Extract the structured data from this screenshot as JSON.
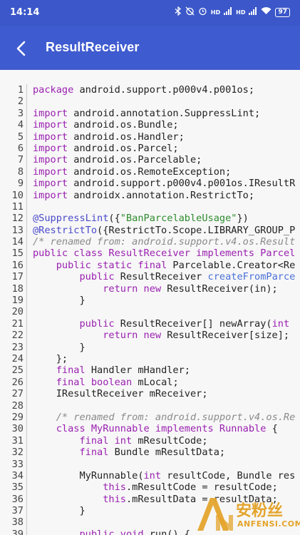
{
  "status_bar": {
    "time": "14:14",
    "network_labels": [
      "HD",
      "HD"
    ],
    "battery": "97"
  },
  "app_bar": {
    "title": "ResultReceiver"
  },
  "code_lines": [
    {
      "n": "1",
      "tokens": [
        {
          "t": "k",
          "v": "package"
        },
        {
          "t": "n",
          "v": " android.support.p000v4.p001os;"
        }
      ]
    },
    {
      "n": "2",
      "tokens": []
    },
    {
      "n": "3",
      "tokens": [
        {
          "t": "k",
          "v": "import"
        },
        {
          "t": "n",
          "v": " android.annotation.SuppressLint;"
        }
      ]
    },
    {
      "n": "4",
      "tokens": [
        {
          "t": "k",
          "v": "import"
        },
        {
          "t": "n",
          "v": " android.os.Bundle;"
        }
      ]
    },
    {
      "n": "5",
      "tokens": [
        {
          "t": "k",
          "v": "import"
        },
        {
          "t": "n",
          "v": " android.os.Handler;"
        }
      ]
    },
    {
      "n": "6",
      "tokens": [
        {
          "t": "k",
          "v": "import"
        },
        {
          "t": "n",
          "v": " android.os.Parcel;"
        }
      ]
    },
    {
      "n": "7",
      "tokens": [
        {
          "t": "k",
          "v": "import"
        },
        {
          "t": "n",
          "v": " android.os.Parcelable;"
        }
      ]
    },
    {
      "n": "8",
      "tokens": [
        {
          "t": "k",
          "v": "import"
        },
        {
          "t": "n",
          "v": " android.os.RemoteException;"
        }
      ]
    },
    {
      "n": "9",
      "tokens": [
        {
          "t": "k",
          "v": "import"
        },
        {
          "t": "n",
          "v": " android.support.p000v4.p001os.IResultR"
        }
      ]
    },
    {
      "n": "10",
      "tokens": [
        {
          "t": "k",
          "v": "import"
        },
        {
          "t": "n",
          "v": " androidx.annotation.RestrictTo;"
        }
      ]
    },
    {
      "n": "11",
      "tokens": []
    },
    {
      "n": "12",
      "tokens": [
        {
          "t": "a",
          "v": "@SuppressLint"
        },
        {
          "t": "n",
          "v": "({"
        },
        {
          "t": "s",
          "v": "\"BanParcelableUsage\""
        },
        {
          "t": "n",
          "v": "})"
        }
      ]
    },
    {
      "n": "13",
      "tokens": [
        {
          "t": "a",
          "v": "@RestrictTo"
        },
        {
          "t": "n",
          "v": "({RestrictTo.Scope.LIBRARY_GROUP_P"
        }
      ]
    },
    {
      "n": "14",
      "tokens": [
        {
          "t": "c",
          "v": "/* renamed from: android.support.v4.os.Result"
        }
      ]
    },
    {
      "n": "15",
      "tokens": [
        {
          "t": "k",
          "v": "public class"
        },
        {
          "t": "n",
          "v": " "
        },
        {
          "t": "k",
          "v": "ResultReceiver"
        },
        {
          "t": "n",
          "v": " "
        },
        {
          "t": "k",
          "v": "implements"
        },
        {
          "t": "n",
          "v": " "
        },
        {
          "t": "k",
          "v": "Parcel"
        }
      ]
    },
    {
      "n": "16",
      "tokens": [
        {
          "t": "n",
          "v": "    "
        },
        {
          "t": "k",
          "v": "public static final"
        },
        {
          "t": "n",
          "v": " Parcelable.Creator<Re"
        }
      ]
    },
    {
      "n": "17",
      "tokens": [
        {
          "t": "n",
          "v": "        "
        },
        {
          "t": "k",
          "v": "public"
        },
        {
          "t": "n",
          "v": " ResultReceiver "
        },
        {
          "t": "m",
          "v": "createFromParce"
        }
      ]
    },
    {
      "n": "18",
      "tokens": [
        {
          "t": "n",
          "v": "            "
        },
        {
          "t": "k",
          "v": "return new"
        },
        {
          "t": "n",
          "v": " ResultReceiver(in);"
        }
      ]
    },
    {
      "n": "19",
      "tokens": [
        {
          "t": "n",
          "v": "        }"
        }
      ]
    },
    {
      "n": "20",
      "tokens": []
    },
    {
      "n": "21",
      "tokens": [
        {
          "t": "n",
          "v": "        "
        },
        {
          "t": "k",
          "v": "public"
        },
        {
          "t": "n",
          "v": " ResultReceiver[] newArray("
        },
        {
          "t": "k",
          "v": "int"
        }
      ]
    },
    {
      "n": "22",
      "tokens": [
        {
          "t": "n",
          "v": "            "
        },
        {
          "t": "k",
          "v": "return new"
        },
        {
          "t": "n",
          "v": " ResultReceiver[size];"
        }
      ]
    },
    {
      "n": "23",
      "tokens": [
        {
          "t": "n",
          "v": "        }"
        }
      ]
    },
    {
      "n": "24",
      "tokens": [
        {
          "t": "n",
          "v": "    };"
        }
      ]
    },
    {
      "n": "25",
      "tokens": [
        {
          "t": "n",
          "v": "    "
        },
        {
          "t": "k",
          "v": "final"
        },
        {
          "t": "n",
          "v": " Handler mHandler;"
        }
      ]
    },
    {
      "n": "26",
      "tokens": [
        {
          "t": "n",
          "v": "    "
        },
        {
          "t": "k",
          "v": "final boolean"
        },
        {
          "t": "n",
          "v": " mLocal;"
        }
      ]
    },
    {
      "n": "27",
      "tokens": [
        {
          "t": "n",
          "v": "    IResultReceiver mReceiver;"
        }
      ]
    },
    {
      "n": "28",
      "tokens": []
    },
    {
      "n": "29",
      "tokens": [
        {
          "t": "n",
          "v": "    "
        },
        {
          "t": "c",
          "v": "/* renamed from: android.support.v4.os.Re"
        }
      ]
    },
    {
      "n": "30",
      "tokens": [
        {
          "t": "n",
          "v": "    "
        },
        {
          "t": "k",
          "v": "class"
        },
        {
          "t": "n",
          "v": " "
        },
        {
          "t": "k",
          "v": "MyRunnable"
        },
        {
          "t": "n",
          "v": " "
        },
        {
          "t": "k",
          "v": "implements"
        },
        {
          "t": "n",
          "v": " "
        },
        {
          "t": "k",
          "v": "Runnable"
        },
        {
          "t": "n",
          "v": " {"
        }
      ]
    },
    {
      "n": "31",
      "tokens": [
        {
          "t": "n",
          "v": "        "
        },
        {
          "t": "k",
          "v": "final int"
        },
        {
          "t": "n",
          "v": " mResultCode;"
        }
      ]
    },
    {
      "n": "32",
      "tokens": [
        {
          "t": "n",
          "v": "        "
        },
        {
          "t": "k",
          "v": "final"
        },
        {
          "t": "n",
          "v": " Bundle mResultData;"
        }
      ]
    },
    {
      "n": "33",
      "tokens": []
    },
    {
      "n": "34",
      "tokens": [
        {
          "t": "n",
          "v": "        MyRunnable("
        },
        {
          "t": "k",
          "v": "int"
        },
        {
          "t": "n",
          "v": " resultCode, Bundle res"
        }
      ]
    },
    {
      "n": "35",
      "tokens": [
        {
          "t": "n",
          "v": "            "
        },
        {
          "t": "k",
          "v": "this"
        },
        {
          "t": "n",
          "v": ".mResultCode = resultCode;"
        }
      ]
    },
    {
      "n": "36",
      "tokens": [
        {
          "t": "n",
          "v": "            "
        },
        {
          "t": "k",
          "v": "this"
        },
        {
          "t": "n",
          "v": ".mResultData = resultData;"
        }
      ]
    },
    {
      "n": "37",
      "tokens": [
        {
          "t": "n",
          "v": "        }"
        }
      ]
    },
    {
      "n": "38",
      "tokens": []
    },
    {
      "n": "39",
      "tokens": [
        {
          "t": "n",
          "v": "        "
        },
        {
          "t": "k",
          "v": "public void"
        },
        {
          "t": "n",
          "v": " run() {"
        }
      ]
    }
  ],
  "watermark": {
    "text": "安粉丝",
    "subtext": "ANFENSI.COM"
  },
  "colors": {
    "status_bar": "#3b57c9",
    "app_bar": "#3f5bd0",
    "keyword": "#9a1fb0",
    "string": "#2e8b2e",
    "comment": "#8a8a8a",
    "annotation": "#4a4acb",
    "watermark": "#e4a42c"
  }
}
